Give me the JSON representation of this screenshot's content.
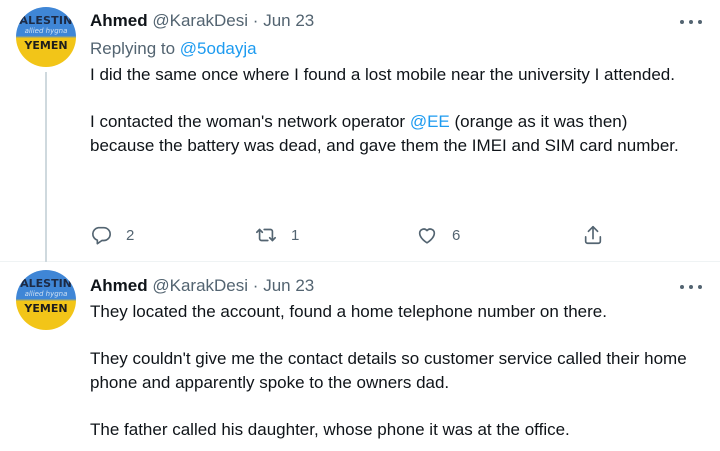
{
  "tweets": [
    {
      "avatar": {
        "line1": "ALESTIN",
        "line2": "allied hygna",
        "line3": "YEMEN"
      },
      "name": "Ahmed",
      "handle": "@KarakDesi",
      "separator": "·",
      "date": "Jun 23",
      "replying_prefix": "Replying to ",
      "replying_to": "@5odayja",
      "body": {
        "p1": "I did the same once where I found a lost mobile near the university I attended.",
        "p2_before": "I contacted the woman's network operator ",
        "p2_mention": "@EE",
        "p2_after": " (orange as it was then) because the battery was dead, and gave them the IMEI and SIM card number."
      },
      "actions": {
        "reply_count": "2",
        "retweet_count": "1",
        "like_count": "6"
      }
    },
    {
      "avatar": {
        "line1": "ALESTIN",
        "line2": "allied hygna",
        "line3": "YEMEN"
      },
      "name": "Ahmed",
      "handle": "@KarakDesi",
      "separator": "·",
      "date": "Jun 23",
      "body": {
        "p1": "They located the account, found a home telephone number on there.",
        "p2": "They couldn't give me the contact details so customer service called their home phone and apparently spoke to the owners dad.",
        "p3": "The father called his daughter, whose phone it was at the office."
      }
    }
  ],
  "colors": {
    "text": "#0f1419",
    "secondary": "#536471",
    "link": "#1d9bf0",
    "thread_line": "#cfd9de"
  },
  "icons": {
    "reply": "speech-bubble",
    "retweet": "retweet-arrows",
    "like": "heart-outline",
    "share": "share-upload",
    "more": "horizontal-ellipsis"
  }
}
